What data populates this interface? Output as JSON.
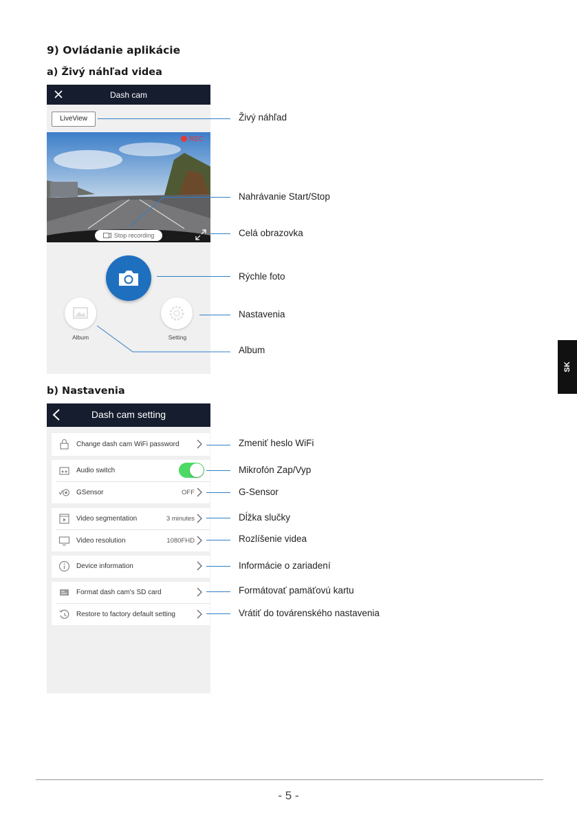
{
  "heading": "9) Ovládanie aplikácie",
  "section_a": "a) Živý náhľad videa",
  "section_b": "b) Nastavenia",
  "side_tab": "SK",
  "page_number": "- 5 -",
  "liveview_screen": {
    "title": "Dash cam",
    "liveview_button": "LiveView",
    "rec_label": "REC",
    "stop_recording": "Stop recording",
    "album_label": "Album",
    "setting_label": "Setting"
  },
  "callouts_a": {
    "live_preview": "Živý náhľad",
    "record_toggle": "Nahrávanie Start/Stop",
    "fullscreen": "Celá obrazovka",
    "quick_photo": "Rýchle foto",
    "settings": "Nastavenia",
    "album": "Album"
  },
  "settings_screen": {
    "title": "Dash cam setting",
    "rows": [
      {
        "label": "Change dash cam WiFi password",
        "value": "",
        "icon": "lock-icon"
      },
      {
        "label": "Audio switch",
        "value": "",
        "icon": "audio-icon",
        "toggle_on": true
      },
      {
        "label": "GSensor",
        "value": "OFF",
        "icon": "gsensor-icon"
      },
      {
        "label": "Video segmentation",
        "value": "3 minutes",
        "icon": "video-segment-icon"
      },
      {
        "label": "Video resolution",
        "value": "1080FHD",
        "icon": "monitor-icon"
      },
      {
        "label": "Device information",
        "value": "",
        "icon": "info-icon"
      },
      {
        "label": "Format dash cam's SD card",
        "value": "",
        "icon": "sd-card-icon"
      },
      {
        "label": "Restore to factory default setting",
        "value": "",
        "icon": "restore-icon"
      }
    ]
  },
  "callouts_b": {
    "wifi": "Zmeniť heslo WiFi",
    "mic": "Mikrofón Zap/Vyp",
    "gsensor": "G-Sensor",
    "loop": "Dĺžka slučky",
    "resolution": "Rozlíšenie videa",
    "device_info": "Informácie o zariadení",
    "format": "Formátovať pamäťovú kartu",
    "restore": "Vrátiť do továrenského nastavenia"
  },
  "colors": {
    "accent_blue": "#1f6fbf",
    "topbar": "#161d2e",
    "toggle_on": "#4cd964",
    "rec_red": "#e53935",
    "callout_line": "#2f7fc6"
  }
}
